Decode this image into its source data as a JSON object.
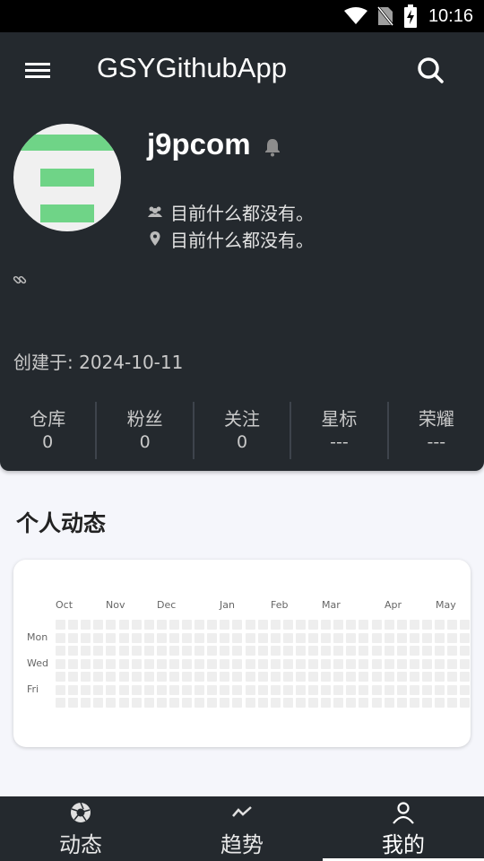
{
  "status_bar": {
    "time": "10:16"
  },
  "app_bar": {
    "title": "GSYGithubApp"
  },
  "profile": {
    "username": "j9pcom",
    "org": "目前什么都没有。",
    "location": "目前什么都没有。",
    "created_label": "创建于:",
    "created_date": "2024-10-11"
  },
  "stats": [
    {
      "label": "仓库",
      "value": "0"
    },
    {
      "label": "粉丝",
      "value": "0"
    },
    {
      "label": "关注",
      "value": "0"
    },
    {
      "label": "星标",
      "value": "---"
    },
    {
      "label": "荣耀",
      "value": "---"
    }
  ],
  "activity": {
    "title": "个人动态",
    "months": [
      "Oct",
      "Nov",
      "Dec",
      "Jan",
      "Feb",
      "Mar",
      "Apr",
      "May"
    ],
    "days": [
      "Mon",
      "Wed",
      "Fri"
    ],
    "empty_color": "#eeeeee"
  },
  "bottom_nav": [
    {
      "label": "动态",
      "icon": "aperture-icon"
    },
    {
      "label": "趋势",
      "icon": "trend-icon"
    },
    {
      "label": "我的",
      "icon": "person-icon",
      "active": true
    }
  ],
  "colors": {
    "primary_dark": "#24292e",
    "background": "#f5f6fb",
    "avatar_accent": "#6fd487"
  }
}
